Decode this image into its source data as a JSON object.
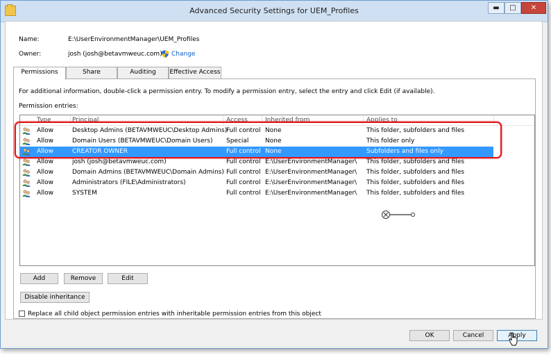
{
  "window": {
    "title": "Advanced Security Settings for UEM_Profiles",
    "minimize_glyph": "▬",
    "maximize_glyph": "□",
    "close_glyph": "✕"
  },
  "info": {
    "name_label": "Name:",
    "name_value": "E:\\UserEnvironmentManager\\UEM_Profiles",
    "owner_label": "Owner:",
    "owner_value": "josh (josh@betavmweuc.com)",
    "change_link": "Change"
  },
  "tabs": [
    {
      "label": "Permissions",
      "active": true
    },
    {
      "label": "Share",
      "active": false
    },
    {
      "label": "Auditing",
      "active": false
    },
    {
      "label": "Effective Access",
      "active": false
    }
  ],
  "permissions": {
    "description": "For additional information, double-click a permission entry. To modify a permission entry, select the entry and click Edit (if available).",
    "entries_label": "Permission entries:",
    "columns": [
      "Type",
      "Principal",
      "Access",
      "Inherited from",
      "Applies to"
    ],
    "rows": [
      {
        "type": "Allow",
        "principal": "Desktop Admins (BETAVMWEUC\\Desktop Admins)",
        "access": "Full control",
        "inherited": "None",
        "applies": "This folder, subfolders and files",
        "selected": false
      },
      {
        "type": "Allow",
        "principal": "Domain Users (BETAVMWEUC\\Domain Users)",
        "access": "Special",
        "inherited": "None",
        "applies": "This folder only",
        "selected": false
      },
      {
        "type": "Allow",
        "principal": "CREATOR OWNER",
        "access": "Full control",
        "inherited": "None",
        "applies": "Subfolders and files only",
        "selected": true
      },
      {
        "type": "Allow",
        "principal": "josh (josh@betavmweuc.com)",
        "access": "Full control",
        "inherited": "E:\\UserEnvironmentManager\\",
        "applies": "This folder, subfolders and files",
        "selected": false
      },
      {
        "type": "Allow",
        "principal": "Domain Admins (BETAVMWEUC\\Domain Admins)",
        "access": "Full control",
        "inherited": "E:\\UserEnvironmentManager\\",
        "applies": "This folder, subfolders and files",
        "selected": false
      },
      {
        "type": "Allow",
        "principal": "Administrators (FILE\\Administrators)",
        "access": "Full control",
        "inherited": "E:\\UserEnvironmentManager\\",
        "applies": "This folder, subfolders and files",
        "selected": false
      },
      {
        "type": "Allow",
        "principal": "SYSTEM",
        "access": "Full control",
        "inherited": "E:\\UserEnvironmentManager\\",
        "applies": "This folder, subfolders and files",
        "selected": false
      }
    ],
    "add_button": "Add",
    "remove_button": "Remove",
    "edit_button": "Edit",
    "disable_inheritance_button": "Disable inheritance",
    "replace_checkbox_label": "Replace all child object permission entries with inheritable permission entries from this object",
    "replace_checked": false
  },
  "footer": {
    "ok_button": "OK",
    "cancel_button": "Cancel",
    "apply_button": "Apply"
  },
  "colors": {
    "selection": "#3399ff",
    "highlight_outline": "#e0161b",
    "link": "#0b5cc4"
  }
}
